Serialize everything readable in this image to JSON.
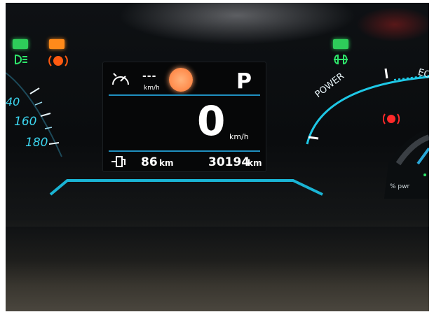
{
  "left_gauge": {
    "ticks": [
      "40",
      "160",
      "180"
    ]
  },
  "display": {
    "cruise_value": "---",
    "cruise_unit": "km/h",
    "gear": "P",
    "speed": "0",
    "speed_unit": "km/h",
    "range_value": "86",
    "range_unit": "km",
    "odometer_value": "30194",
    "odometer_unit": "km"
  },
  "power_gauge": {
    "label": "POWER",
    "eco_label": "EC",
    "battery_label": "% pwr"
  },
  "colors": {
    "accent": "#1ec8e6",
    "green_light": "#22c45a",
    "amber_light": "#ff8a1a",
    "warning_red": "#ff2a2a"
  },
  "icons": [
    "headlight-icon",
    "parking-brake-icon",
    "fog-light-icon",
    "cruise-control-icon",
    "fuel-pump-icon",
    "brake-warning-icon",
    "sun-icon"
  ]
}
